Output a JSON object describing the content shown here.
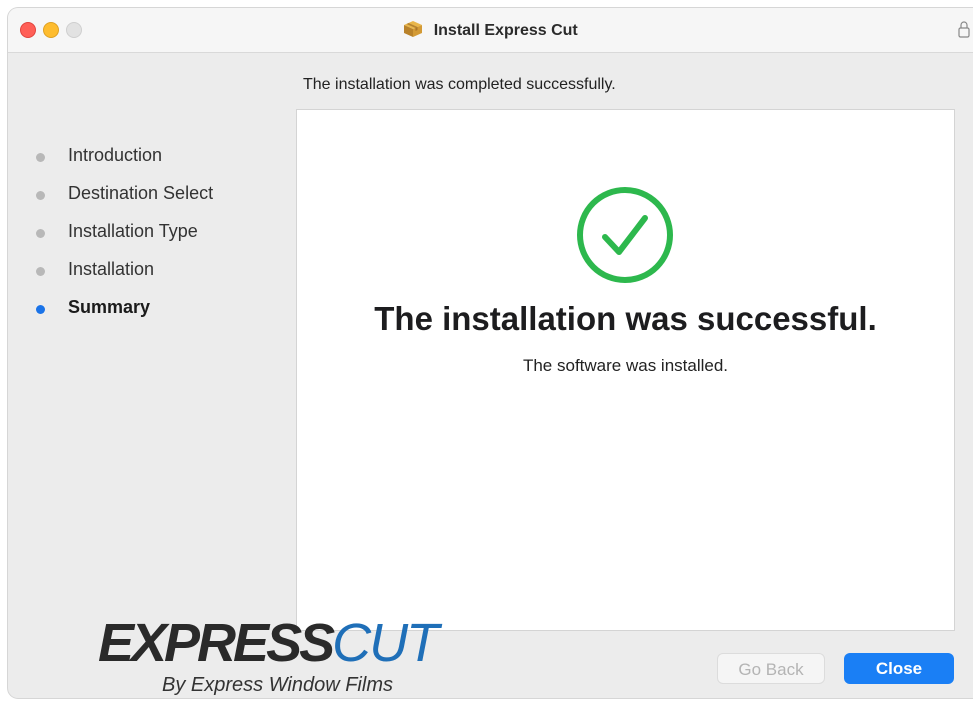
{
  "window": {
    "title": "Install Express Cut"
  },
  "header": {
    "text": "The installation was completed successfully."
  },
  "sidebar": {
    "steps": [
      {
        "label": "Introduction",
        "active": false
      },
      {
        "label": "Destination Select",
        "active": false
      },
      {
        "label": "Installation Type",
        "active": false
      },
      {
        "label": "Installation",
        "active": false
      },
      {
        "label": "Summary",
        "active": true
      }
    ]
  },
  "main": {
    "status_icon": "checkmark-circle-icon",
    "title": "The installation was successful.",
    "subtitle": "The software was installed."
  },
  "logo": {
    "brand_main": "EXPRESS",
    "brand_cut": "CUT",
    "tagline": "By Express Window Films"
  },
  "buttons": {
    "back_label": "Go Back",
    "close_label": "Close"
  },
  "colors": {
    "accent": "#1a7ff5",
    "success": "#2db84d",
    "active_step": "#1a73e8"
  }
}
